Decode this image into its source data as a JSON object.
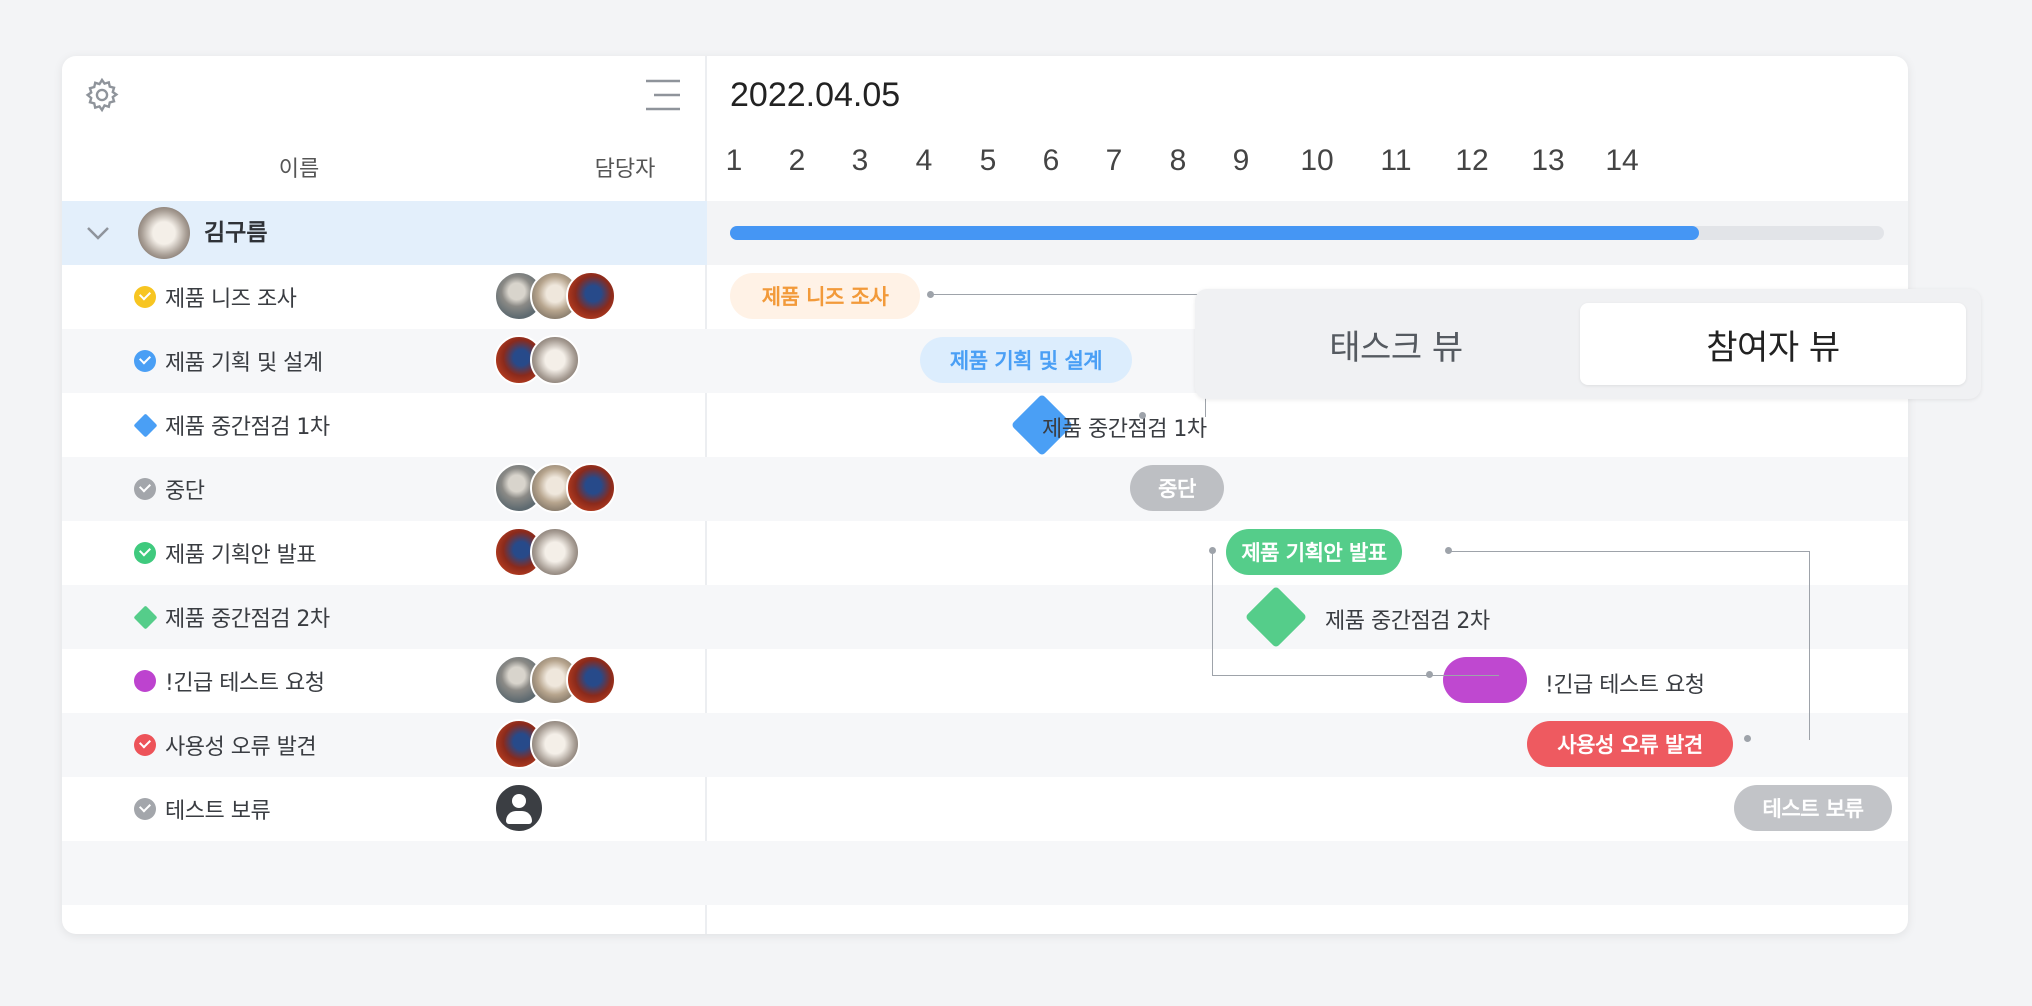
{
  "header": {
    "date": "2022.04.05",
    "days": [
      "1",
      "2",
      "3",
      "4",
      "5",
      "6",
      "7",
      "8",
      "9",
      "10",
      "11",
      "12",
      "13",
      "14"
    ],
    "col_name": "이름",
    "col_assignee": "담당자"
  },
  "icons": {
    "settings": "gear-icon",
    "menu": "hamburger-menu-icon",
    "collapse": "chevron-down-icon"
  },
  "group": {
    "name": "김구름",
    "progress": 0.84,
    "progress_color": "#4596f4"
  },
  "tasks": [
    {
      "name": "제품 니즈 조사",
      "status_color": "#f7c521",
      "type": "task",
      "bar_label": "제품 니즈 조사",
      "bar_bg": "#fff2e6",
      "bar_fg": "#f29a3a"
    },
    {
      "name": "제품 기획 및 설계",
      "status_color": "#4a9ff5",
      "type": "task",
      "bar_label": "제품 기획 및 설계",
      "bar_bg": "#dcedfd",
      "bar_fg": "#4a9ff5"
    },
    {
      "name": "제품 중간점검 1차",
      "status_color": "#4a9ff5",
      "type": "milestone",
      "bar_label": "제품 중간점검 1차"
    },
    {
      "name": "중단",
      "status_color": "#a3a6ab",
      "type": "task",
      "bar_label": "중단",
      "bar_bg": "#bdbfc3",
      "bar_fg": "#ffffff"
    },
    {
      "name": "제품 기획안 발표",
      "status_color": "#3fca7e",
      "type": "task",
      "bar_label": "제품 기획안 발표",
      "bar_bg": "#55cd8a",
      "bar_fg": "#ffffff"
    },
    {
      "name": "제품 중간점검 2차",
      "status_color": "#55cd8a",
      "type": "milestone",
      "bar_label": "제품 중간점검 2차"
    },
    {
      "name": "!긴급 테스트 요청",
      "status_color": "#bd43cf",
      "type": "task",
      "bar_label": "!긴급 테스트 요청",
      "bar_bg": "#bf48d0",
      "bar_fg": "#ffffff"
    },
    {
      "name": "사용성 오류 발견",
      "status_color": "#ed5359",
      "type": "task",
      "bar_label": "사용성 오류 발견",
      "bar_bg": "#ee5a60",
      "bar_fg": "#ffffff"
    },
    {
      "name": "테스트 보류",
      "status_color": "#a3a6ab",
      "type": "task",
      "bar_label": "테스트 보류",
      "bar_bg": "#c2c4c8",
      "bar_fg": "#ffffff"
    }
  ],
  "view_toggle": {
    "task_view": "태스크 뷰",
    "participant_view": "참여자 뷰",
    "selected": "참여자 뷰"
  }
}
